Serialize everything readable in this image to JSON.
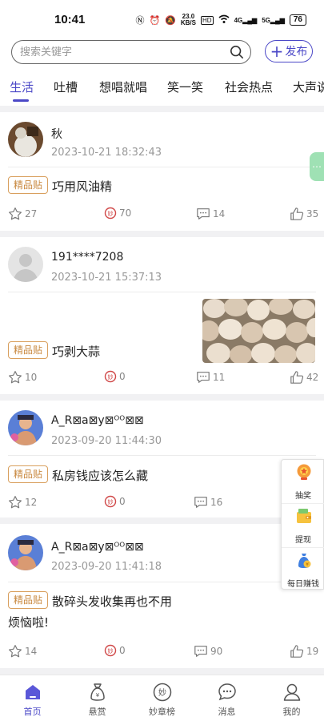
{
  "status_bar": {
    "time": "10:41",
    "speed_top": "23.0",
    "speed_unit": "KB/S",
    "hd": "HD",
    "signal1": "4G",
    "signal2": "5G",
    "battery": "76"
  },
  "search": {
    "placeholder": "搜索关键字"
  },
  "publish_label": "发布",
  "tabs": [
    {
      "label": "生活",
      "active": true
    },
    {
      "label": "吐槽"
    },
    {
      "label": "想唱就唱"
    },
    {
      "label": "笑一笑"
    },
    {
      "label": "社会热点"
    },
    {
      "label": "大声说"
    }
  ],
  "badge_label": "精品贴",
  "posts": [
    {
      "user": "秋",
      "time": "2023-10-21 18:32:43",
      "title": "巧用风油精",
      "stars": "27",
      "coins": "70",
      "comments": "14",
      "likes": "35"
    },
    {
      "user": "191****7208",
      "time": "2023-10-21 15:37:13",
      "title": "巧剥大蒜",
      "stars": "10",
      "coins": "0",
      "comments": "11",
      "likes": "42"
    },
    {
      "user": "A_R⊠a⊠y⊠ᴼᴼ⊠⊠",
      "time": "2023-09-20 11:44:30",
      "title": "私房钱应该怎么藏",
      "stars": "12",
      "coins": "0",
      "comments": "16",
      "likes": ""
    },
    {
      "user": "A_R⊠a⊠y⊠ᴼᴼ⊠⊠",
      "time": "2023-09-20 11:41:18",
      "title": "散碎头发收集再也不用",
      "title_line2": "烦恼啦!",
      "stars": "14",
      "coins": "0",
      "comments": "90",
      "likes": "19"
    }
  ],
  "side_panel": [
    {
      "label": "抽奖",
      "icon": "lottery-icon"
    },
    {
      "label": "提现",
      "icon": "wallet-icon"
    },
    {
      "label": "每日赚钱",
      "icon": "money-bag-icon"
    }
  ],
  "bottom_nav": [
    {
      "label": "首页",
      "icon": "home-icon",
      "active": true
    },
    {
      "label": "悬赏",
      "icon": "reward-bag-icon"
    },
    {
      "label": "妙章榜",
      "icon": "ranking-icon"
    },
    {
      "label": "消息",
      "icon": "message-icon"
    },
    {
      "label": "我的",
      "icon": "profile-icon"
    }
  ],
  "colors": {
    "accent": "#4b48c7",
    "badge": "#c8883f",
    "background_gap": "#f1f1f3"
  }
}
